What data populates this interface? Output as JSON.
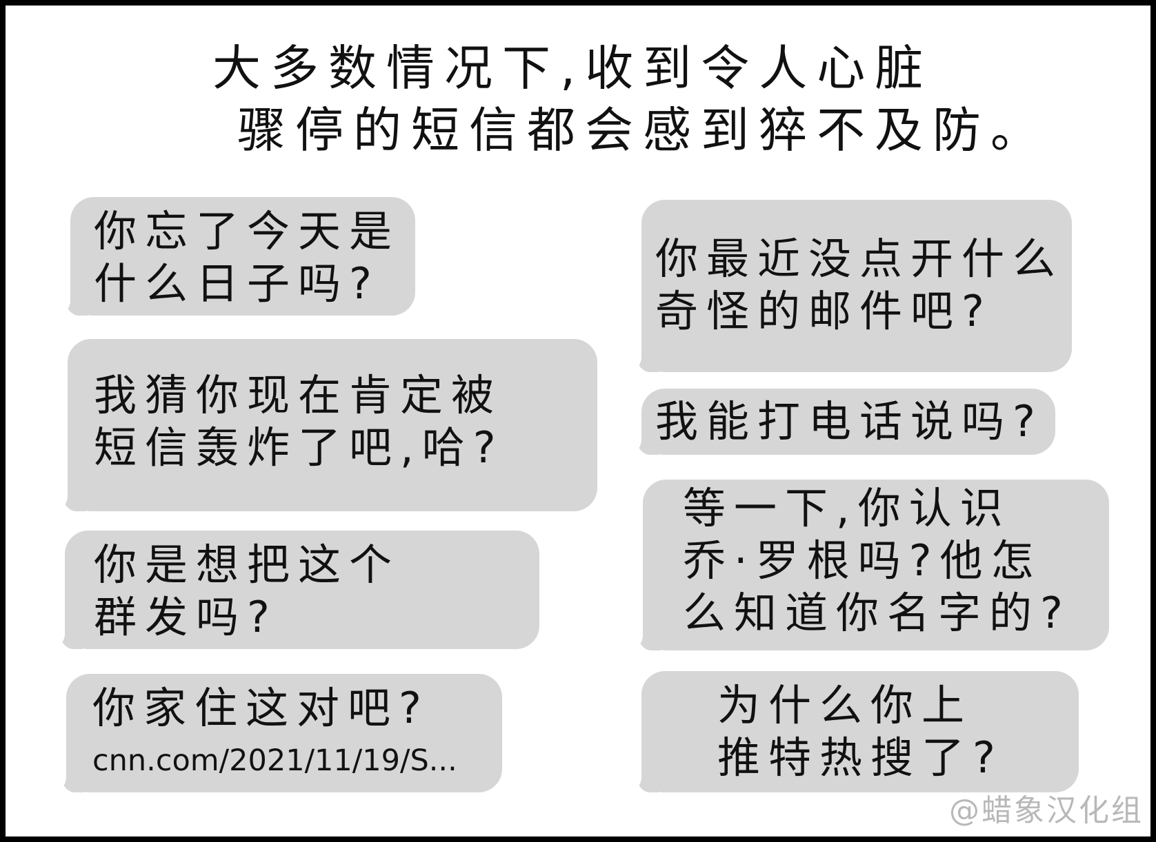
{
  "caption": {
    "line1": "大多数情况下,收到令人心脏",
    "line2": "骤停的短信都会感到猝不及防。"
  },
  "left_bubbles": [
    {
      "line1": "你忘了今天是",
      "line2": "什么日子吗?"
    },
    {
      "line1": "我猜你现在肯定被",
      "line2": "短信轰炸了吧,哈?"
    },
    {
      "line1": "你是想把这个",
      "line2": "群发吗?"
    },
    {
      "line1": "你家住这对吧?",
      "line2": "cnn.com/2021/11/19/S..."
    }
  ],
  "right_bubbles": [
    {
      "line1": "你最近没点开什么",
      "line2": "奇怪的邮件吧?"
    },
    {
      "line1": "我能打电话说吗?"
    },
    {
      "line1": "等一下,你认识",
      "line2": "乔·罗根吗?他怎",
      "line3": "么知道你名字的?"
    },
    {
      "line1": "为什么你上",
      "line2": "推特热搜了?"
    }
  ],
  "watermark": "@蜡象汉化组",
  "colors": {
    "bubble": "#d6d6d6",
    "text": "#111111",
    "border": "#000000",
    "background": "#ffffff",
    "watermark": "#b8b8b8"
  }
}
